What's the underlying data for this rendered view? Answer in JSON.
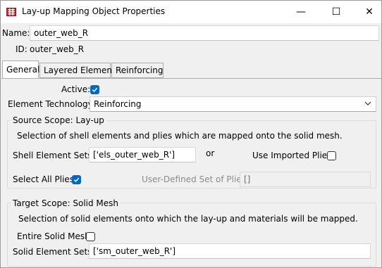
{
  "window": {
    "title": "Lay-up Mapping Object Properties",
    "controls": {
      "minimize": "—",
      "maximize": "☐",
      "close": "✕"
    }
  },
  "header": {
    "name_label": "Name:",
    "name_value": "outer_web_R",
    "id_label": "ID:",
    "id_value": "outer_web_R"
  },
  "tabs": [
    {
      "label": "General",
      "active": true
    },
    {
      "label": "Layered Element",
      "active": false
    },
    {
      "label": "Reinforcing",
      "active": false
    }
  ],
  "general": {
    "active_label": "Active:",
    "active_checked": true,
    "element_technology_label": "Element Technology:",
    "element_technology_value": "Reinforcing",
    "source_scope": {
      "title": "Source Scope: Lay-up",
      "description": "Selection of shell elements and plies which are mapped onto the solid mesh.",
      "shell_element_sets_label": "Shell Element Sets:",
      "shell_element_sets_value": "['els_outer_web_R']",
      "or_label": "or",
      "use_imported_plies_label": "Use Imported Plies:",
      "use_imported_plies_checked": false,
      "select_all_plies_label": "Select All Plies:",
      "select_all_plies_checked": true,
      "user_defined_plies_label": "User-Defined Set of Plies:",
      "user_defined_plies_value": "[]"
    },
    "target_scope": {
      "title": "Target Scope: Solid Mesh",
      "description": "Selection of solid elements onto which the lay-up and materials will be mapped.",
      "entire_solid_mesh_label": "Entire Solid Mesh:",
      "entire_solid_mesh_checked": false,
      "solid_element_sets_label": "Solid Element Sets:",
      "solid_element_sets_value": "['sm_outer_web_R']"
    }
  },
  "colors": {
    "accent": "#0067c0",
    "window_bg": "#f0f0f0",
    "icon_red": "#b5121b"
  },
  "icons": {
    "app": "acp-app-icon",
    "checkmark": "checkmark-icon",
    "dropdown": "chevron-down-icon"
  }
}
